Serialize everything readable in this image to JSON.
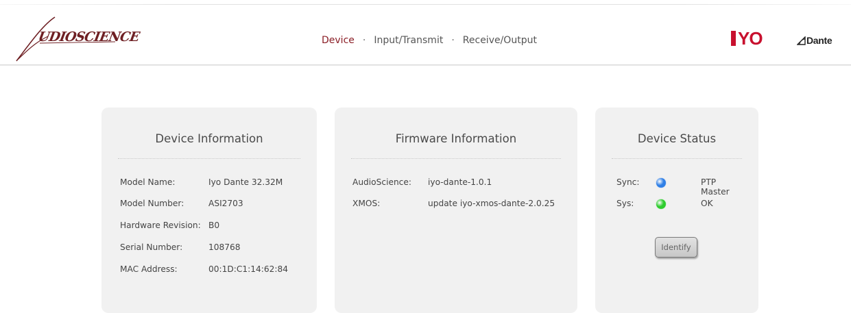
{
  "brand": {
    "logo_text": "UDIOSCIENCE",
    "partner_logo_text": "YO",
    "dante_logo_text": "Dante"
  },
  "nav": {
    "items": [
      {
        "label": "Device",
        "active": true
      },
      {
        "label": "Input/Transmit",
        "active": false
      },
      {
        "label": "Receive/Output",
        "active": false
      }
    ],
    "separator": "·"
  },
  "device_info": {
    "title": "Device Information",
    "rows": [
      {
        "label": "Model Name:",
        "value": "Iyo Dante 32.32M"
      },
      {
        "label": "Model Number:",
        "value": "ASI2703"
      },
      {
        "label": "Hardware Revision:",
        "value": "B0"
      },
      {
        "label": "Serial Number:",
        "value": "108768"
      },
      {
        "label": "MAC Address:",
        "value": "00:1D:C1:14:62:84"
      }
    ]
  },
  "firmware_info": {
    "title": "Firmware Information",
    "rows": [
      {
        "label": "AudioScience:",
        "value": "iyo-dante-1.0.1"
      },
      {
        "label": "XMOS:",
        "value": "update iyo-xmos-dante-2.0.25"
      }
    ]
  },
  "device_status": {
    "title": "Device Status",
    "rows": [
      {
        "label": "Sync:",
        "value": "PTP Master",
        "indicator_color": "#2f7fe6"
      },
      {
        "label": "Sys:",
        "value": "OK",
        "indicator_color": "#2ecc2e"
      }
    ],
    "identify_label": "Identify"
  },
  "colors": {
    "brand_maroon": "#8a1d25",
    "iyo_red": "#c8102e",
    "card_background": "#f1f1f1"
  }
}
